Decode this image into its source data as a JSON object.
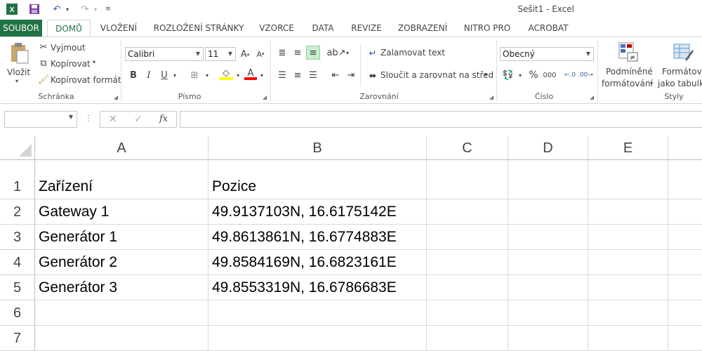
{
  "window": {
    "title": "Sešit1 - Excel"
  },
  "quick_access": {
    "app_icon": "excel-logo-icon",
    "save_icon": "save-icon",
    "undo_icon": "undo-icon",
    "redo_icon": "redo-icon"
  },
  "tabs": [
    {
      "label": "SOUBOR"
    },
    {
      "label": "DOMŮ"
    },
    {
      "label": "VLOŽENÍ"
    },
    {
      "label": "ROZLOŽENÍ STRÁNKY"
    },
    {
      "label": "VZORCE"
    },
    {
      "label": "DATA"
    },
    {
      "label": "REVIZE"
    },
    {
      "label": "ZOBRAZENÍ"
    },
    {
      "label": "NITRO PRO"
    },
    {
      "label": "ACROBAT"
    }
  ],
  "ribbon": {
    "clipboard": {
      "paste": "Vložit",
      "cut": "Vyjmout",
      "copy": "Kopírovat",
      "format_painter": "Kopírovat formát",
      "label": "Schránka"
    },
    "font": {
      "name": "Calibri",
      "size": "11",
      "bold": "B",
      "italic": "I",
      "underline": "U",
      "label": "Písmo"
    },
    "alignment": {
      "wrap": "Zalamovat text",
      "merge": "Sloučit a zarovnat na střed",
      "label": "Zarovnání"
    },
    "number": {
      "format": "Obecný",
      "percent": "%",
      "thousands": "000",
      "label": "Číslo"
    },
    "styles": {
      "cond_line1": "Podmíněné",
      "cond_line2": "formátování",
      "table_line1": "Formátova",
      "table_line2": "jako tabulku",
      "label": "Styly"
    }
  },
  "formula_bar": {
    "cancel": "✕",
    "enter": "✓",
    "fx": "fx"
  },
  "sheet": {
    "columns": [
      "A",
      "B",
      "C",
      "D",
      "E"
    ],
    "rows": [
      "1",
      "2",
      "3",
      "4",
      "5",
      "6",
      "7"
    ],
    "cells": [
      [
        "Zařízení",
        "Pozice"
      ],
      [
        "Gateway 1",
        "49.9137103N, 16.6175142E"
      ],
      [
        "Generátor 1",
        "49.8613861N, 16.6774883E"
      ],
      [
        "Generátor 2",
        "49.8584169N, 16.6823161E"
      ],
      [
        "Generátor 3",
        "49.8553319N, 16.6786683E"
      ],
      [
        "",
        ""
      ],
      [
        "",
        ""
      ]
    ]
  },
  "colors": {
    "accent": "#217346",
    "fill_highlight": "#ffff00",
    "font_color": "#ff0000"
  }
}
